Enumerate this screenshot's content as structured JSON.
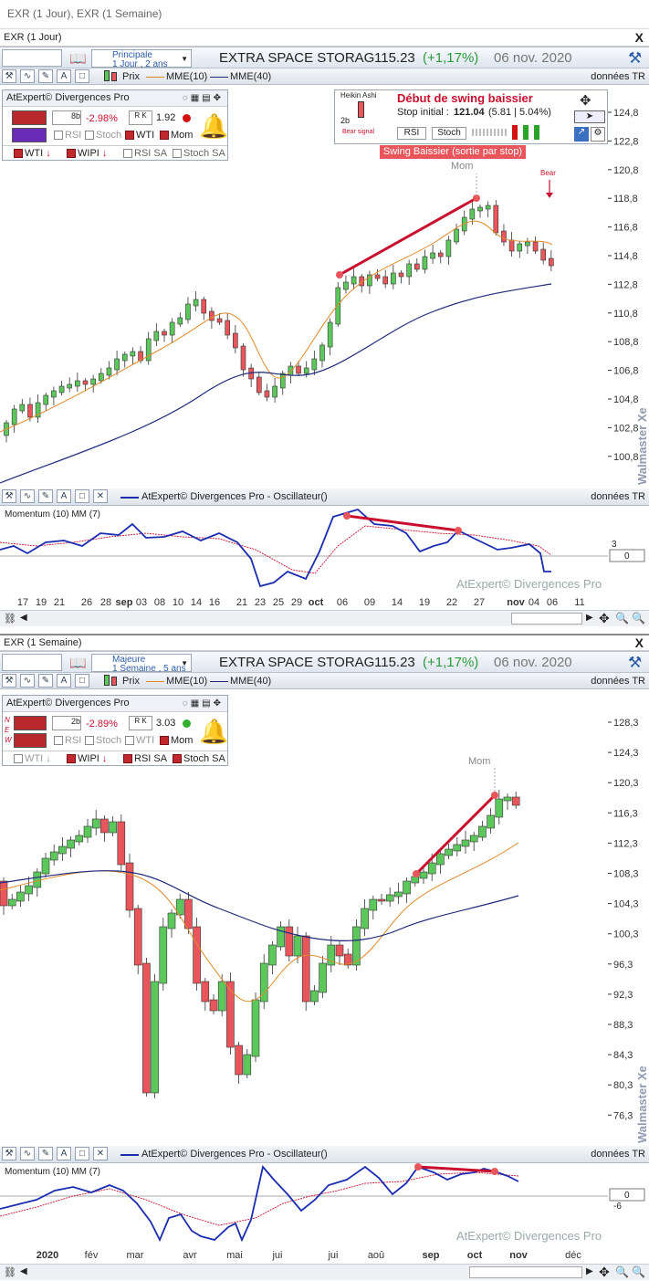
{
  "window": {
    "title": "EXR (1 Jour), EXR (1 Semaine)"
  },
  "top": {
    "panel_title": "EXR (1 Jour)",
    "close": "X",
    "mode_name": "Principale",
    "mode_period": "1 Jour , 2 ans",
    "instrument": "EXTRA SPACE STORAG",
    "price": "115.23",
    "change": "(+1,17%)",
    "date": "06 nov. 2020",
    "toolbar": {
      "prix": "Prix",
      "mme10": "MME(10)",
      "mme40": "MME(40)",
      "source": "données TR"
    },
    "expert": {
      "title": "AtExpert© Divergences Pro",
      "pct": "-2.98%",
      "num": "1.92",
      "ab": "8b",
      "rsi": "RSI",
      "stoch": "Stoch",
      "wti": "WTI",
      "mom": "Mom",
      "wti2": "WTI",
      "wipi": "WIPI",
      "rsisa": "RSI SA",
      "stochsa": "Stoch SA"
    },
    "signal": {
      "ha": "Heikin Ashi",
      "bear_signal": "Bear signal",
      "b2": "2b",
      "heading": "Début de swing baissier",
      "stop_label": "Stop initial :",
      "stop_value": "121.04",
      "stop_detail": "(5.81 | 5.04%)",
      "rsi": "RSI",
      "stoch": "Stoch",
      "banner": "Swing Baissier (sortie par stop)"
    },
    "annotations": {
      "mom": "Mom",
      "bear": "Bear"
    },
    "yticks": [
      "124,8",
      "122,8",
      "120,8",
      "118,8",
      "116,8",
      "114,8",
      "112,8",
      "110,8",
      "108,8",
      "106,8",
      "104,8",
      "102,8",
      "100,8"
    ],
    "watermark": "Walmaster Xe",
    "osc": {
      "title": "AtExpert© Divergences Pro - Oscillateur()",
      "source": "données TR",
      "label": "Momentum (10) MM (7)",
      "level": "3",
      "value": "0",
      "brand": "AtExpert© Divergences Pro"
    },
    "xticks": [
      "17",
      "19",
      "21",
      "26",
      "28",
      "sep",
      "03",
      "08",
      "10",
      "14",
      "16",
      "21",
      "23",
      "25",
      "29",
      "oct",
      "06",
      "09",
      "14",
      "19",
      "22",
      "27",
      "nov",
      "04",
      "06",
      "11"
    ]
  },
  "bottom": {
    "panel_title": "EXR (1 Semaine)",
    "close": "X",
    "mode_name": "Majeure",
    "mode_period": "1 Semaine , 5 ans",
    "instrument": "EXTRA SPACE STORAG",
    "price": "115.23",
    "change": "(+1,17%)",
    "date": "06 nov. 2020",
    "toolbar": {
      "prix": "Prix",
      "mme10": "MME(10)",
      "mme40": "MME(40)",
      "source": "données TR"
    },
    "expert": {
      "title": "AtExpert© Divergences Pro",
      "pct": "-2.89%",
      "num": "3.03",
      "ab": "2b",
      "rsi": "RSI",
      "stoch": "Stoch",
      "wti": "WTI",
      "mom": "Mom",
      "wti2": "WTI",
      "wipi": "WIPI",
      "rsisa": "RSI SA",
      "stochsa": "Stoch SA",
      "new": "NEW"
    },
    "annotations": {
      "mom": "Mom"
    },
    "yticks": [
      "128,3",
      "124,3",
      "120,3",
      "116,3",
      "112,3",
      "108,3",
      "104,3",
      "100,3",
      "96,3",
      "92,3",
      "88,3",
      "84,3",
      "80,3",
      "76,3"
    ],
    "watermark": "Walmaster Xe",
    "osc": {
      "title": "AtExpert© Divergences Pro - Oscillateur()",
      "source": "données TR",
      "label": "Momentum (10) MM (7)",
      "level": "-6",
      "value": "0",
      "brand": "AtExpert© Divergences Pro"
    },
    "xticks": [
      "2020",
      "fév",
      "mar",
      "avr",
      "mai",
      "jui",
      "jui",
      "aoû",
      "sep",
      "oct",
      "nov",
      "déc"
    ]
  },
  "colors": {
    "up": "#5cc85c",
    "down": "#e8565b",
    "mme10": "#e08a2a",
    "mme40": "#1d2a7a",
    "osc": "#1a2cb0",
    "signal": "#c8102e"
  }
}
